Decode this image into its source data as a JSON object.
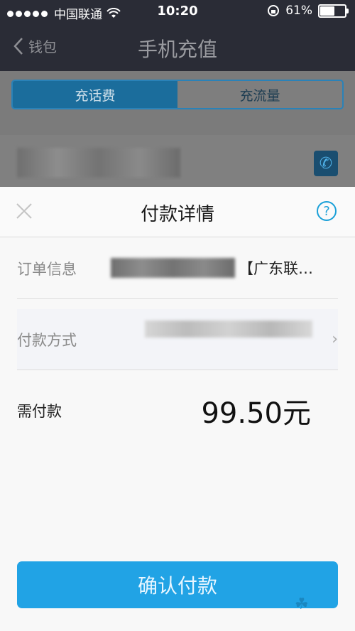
{
  "status": {
    "carrier": "中国联通",
    "time": "10:20",
    "battery": "61%",
    "battery_level": 0.61
  },
  "nav": {
    "back_label": "钱包",
    "title": "手机充值"
  },
  "tabs": [
    {
      "label": "充话费",
      "active": true
    },
    {
      "label": "充流量",
      "active": false
    }
  ],
  "sheet": {
    "title": "付款详情",
    "order": {
      "label": "订单信息",
      "value": "【广东联…"
    },
    "payment": {
      "label": "付款方式"
    },
    "amount": {
      "label": "需付款",
      "value": "99.50元"
    },
    "confirm_label": "确认付款"
  },
  "colors": {
    "accent": "#21a3e5",
    "nav_bg": "#2a2c36"
  },
  "icons": {
    "back": "chevron-left-icon",
    "contact": "phone-book-icon",
    "close": "close-icon",
    "help": "question-circle-icon",
    "chevron": "chevron-right-icon",
    "wifi": "wifi-icon",
    "lock": "rotation-lock-icon"
  }
}
